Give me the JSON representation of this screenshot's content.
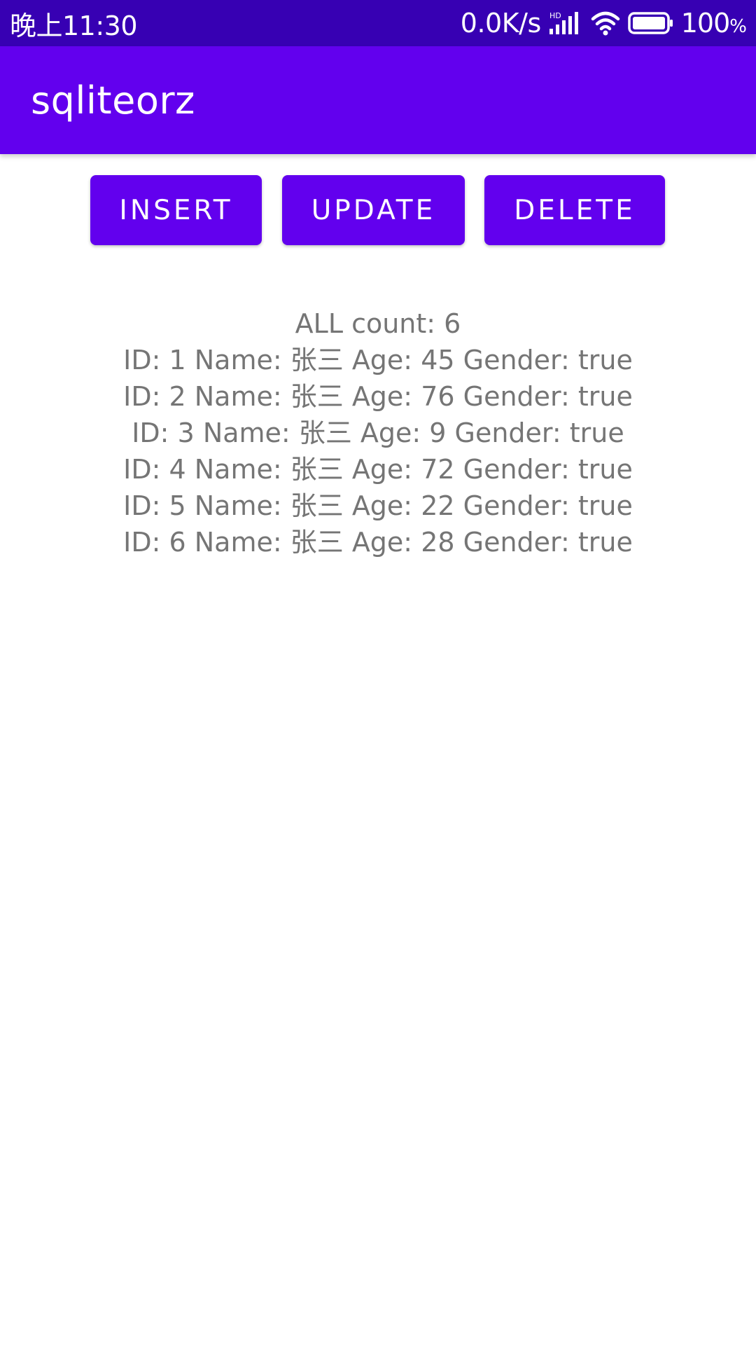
{
  "status_bar": {
    "time": "晚上11:30",
    "net_speed": "0.0K/s",
    "network_badge": "HD",
    "battery_percent": "100",
    "battery_unit": "%",
    "icons": [
      "signal-icon",
      "wifi-icon",
      "battery-icon"
    ]
  },
  "app_bar": {
    "title": "sqliteorz"
  },
  "buttons": {
    "insert": "INSERT",
    "update": "UPDATE",
    "delete": "DELETE"
  },
  "records": {
    "summary": "ALL count: 6",
    "rows": [
      "ID: 1 Name: 张三 Age: 45 Gender: true",
      "ID: 2 Name: 张三 Age: 76 Gender: true",
      "ID: 3 Name: 张三 Age: 9 Gender: true",
      "ID: 4 Name: 张三 Age: 72 Gender: true",
      "ID: 5 Name: 张三 Age: 22 Gender: true",
      "ID: 6 Name: 张三 Age: 28 Gender: true"
    ]
  },
  "colors": {
    "status_bar": "#3700b3",
    "primary": "#6200ee",
    "text_secondary": "#757575",
    "background": "#ffffff"
  }
}
